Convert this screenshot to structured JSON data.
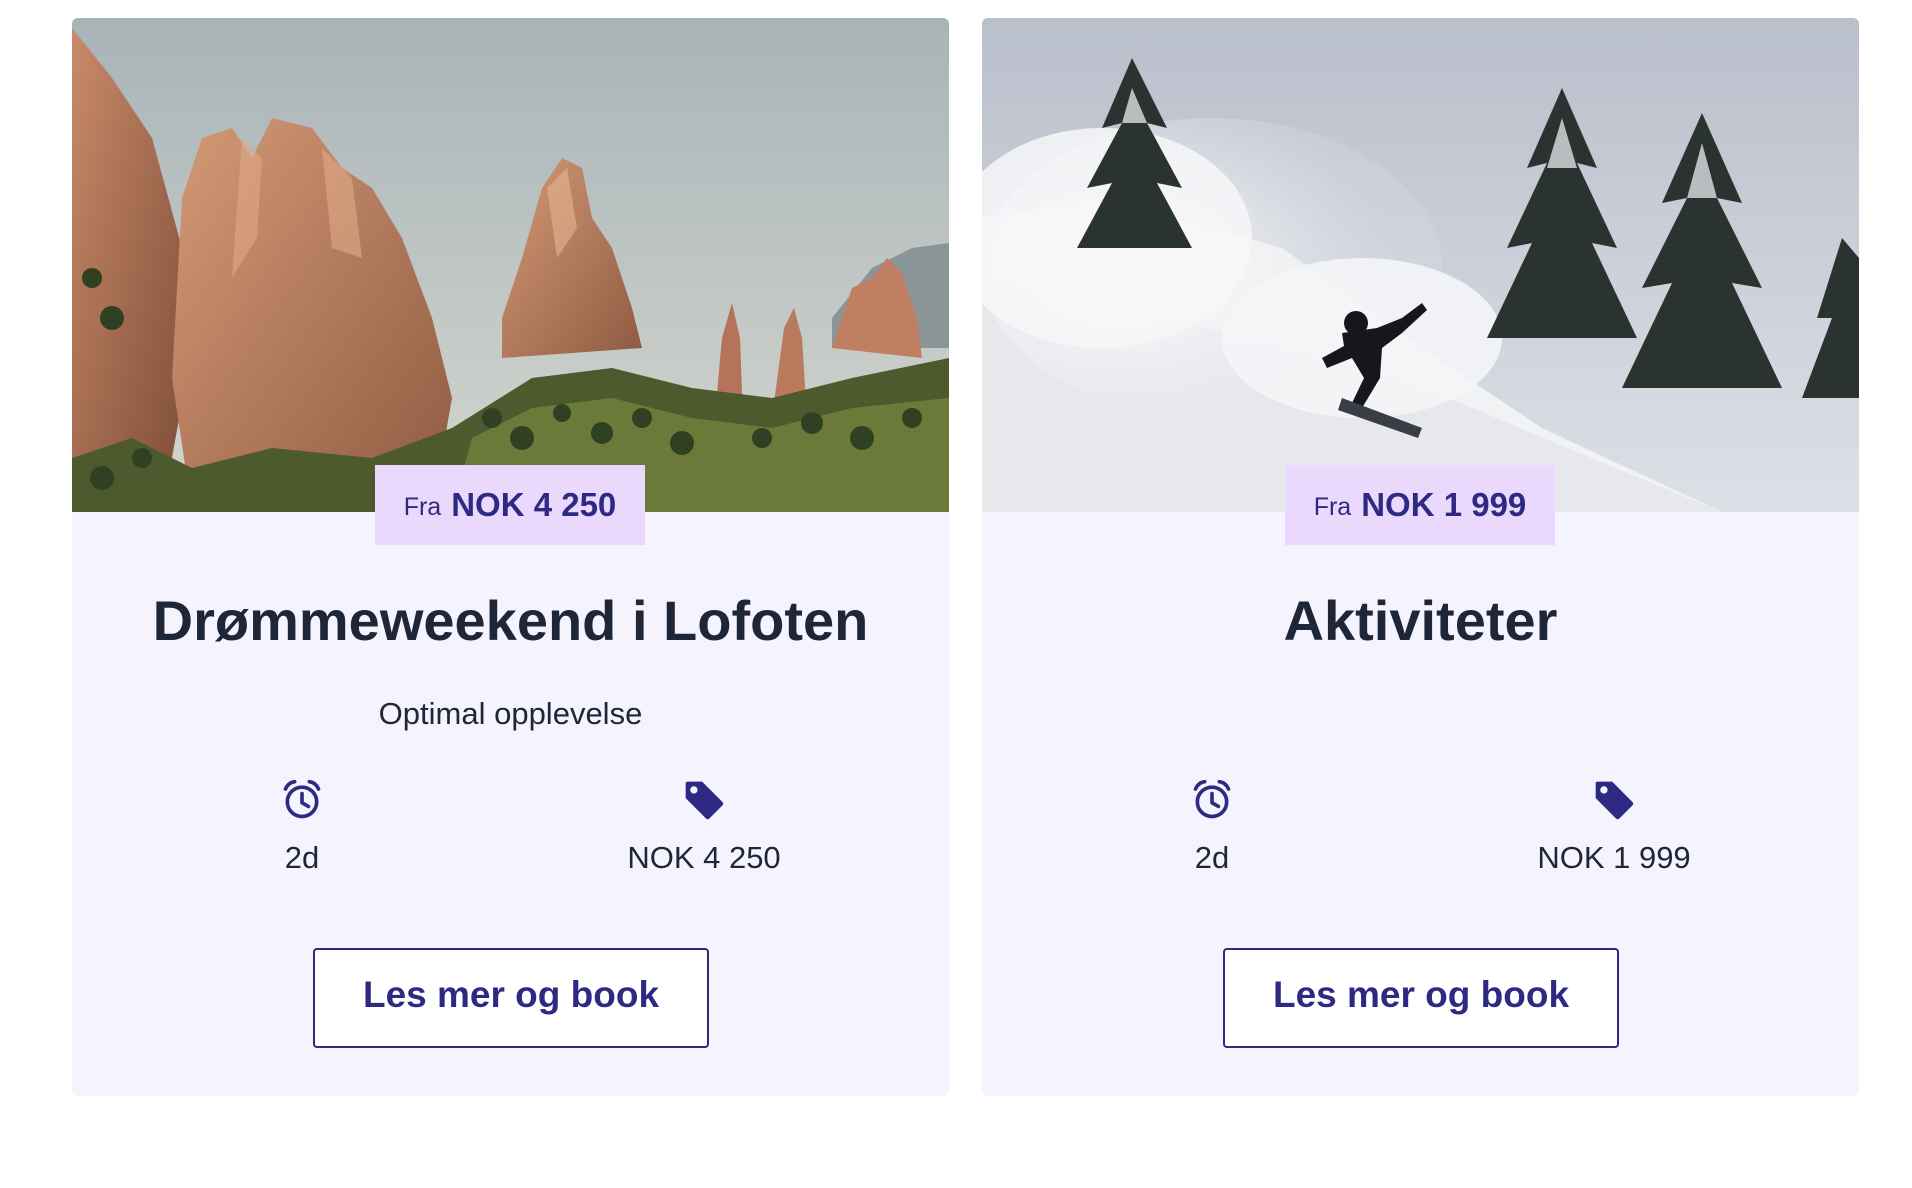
{
  "colors": {
    "card_background": "#f5f4fe",
    "price_tag_background": "#ead8fd",
    "accent": "#2e2a84",
    "text": "#1e2637"
  },
  "cards": [
    {
      "image": "rock-formations-mountain-photo",
      "price_tag": {
        "prefix": "Fra",
        "amount": "NOK 4 250"
      },
      "title": "Drømmeweekend i Lofoten",
      "subtitle": "Optimal opplevelse",
      "duration": {
        "icon": "alarm-clock-icon",
        "label": "2d"
      },
      "price": {
        "icon": "price-tag-icon",
        "label": "NOK 4 250"
      },
      "cta_label": "Les mer og book"
    },
    {
      "image": "snowboarder-powder-photo",
      "price_tag": {
        "prefix": "Fra",
        "amount": "NOK 1 999"
      },
      "title": "Aktiviteter",
      "subtitle": "",
      "duration": {
        "icon": "alarm-clock-icon",
        "label": "2d"
      },
      "price": {
        "icon": "price-tag-icon",
        "label": "NOK 1 999"
      },
      "cta_label": "Les mer og book"
    }
  ]
}
